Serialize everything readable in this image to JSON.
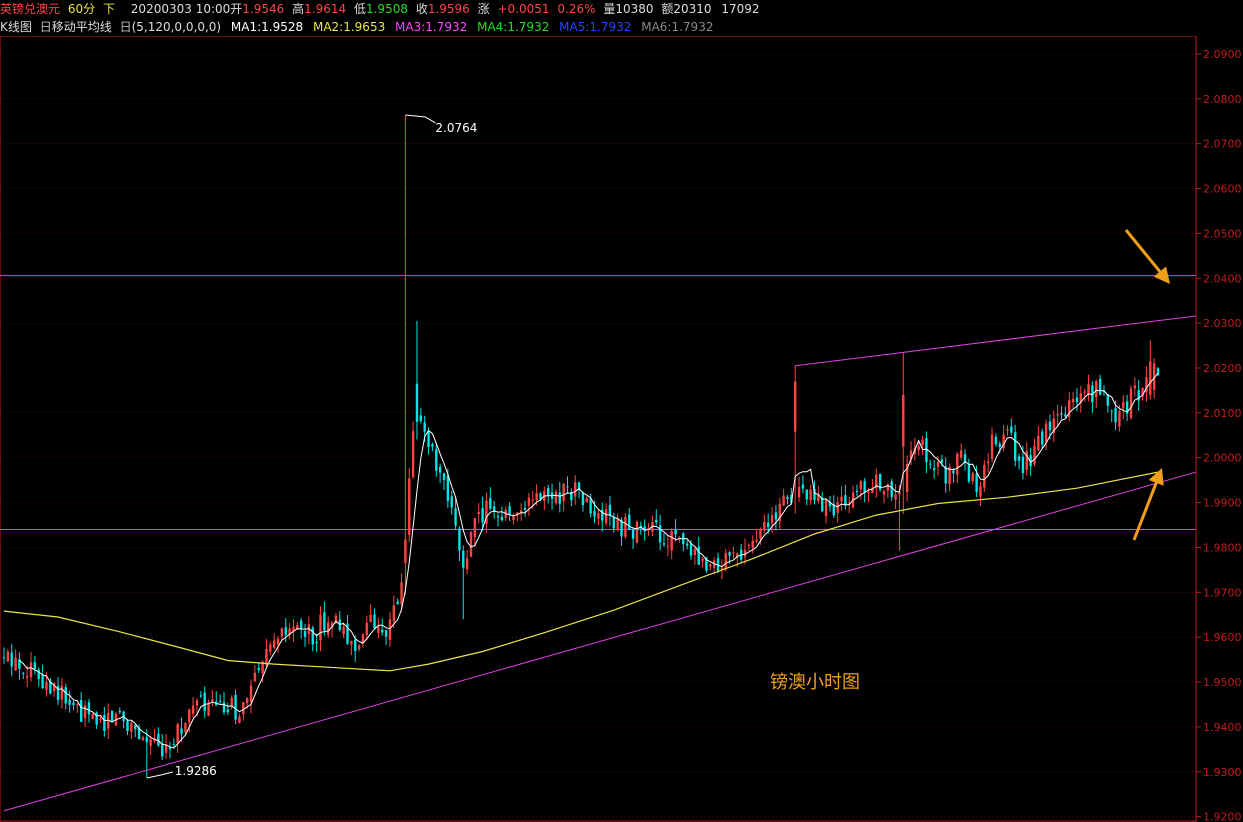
{
  "header": {
    "symbol": "英镑兑澳元",
    "period": "60分",
    "direction": "下",
    "datetime": "20200303 10:00",
    "open_label": "开",
    "open": "1.9546",
    "high_label": "高",
    "high": "1.9614",
    "low_label": "低",
    "low": "1.9508",
    "close_label": "收",
    "close": "1.9596",
    "change_label": "涨",
    "change": "+0.0051",
    "change_pct": "0.26%",
    "volume_label": "量",
    "volume": "10380",
    "amount_label": "额",
    "amount": "20310",
    "extra": "17092"
  },
  "indicator_bar": {
    "title": "K线图",
    "icon1": "日",
    "ma_name": "移动平均线",
    "icon2": "日",
    "params": "(5,120,0,0,0,0)",
    "ma1": "MA1:1.9528",
    "ma2": "MA2:1.9653",
    "ma3": "MA3:1.7932",
    "ma4": "MA4:1.7932",
    "ma5": "MA5:1.7932",
    "ma6": "MA6:1.7932"
  },
  "colors": {
    "up": "#ff4444",
    "down": "#00e5e5",
    "axis": "#c41a1a",
    "ma1": "#ffffff",
    "ma2": "#e8e44a",
    "ma3": "#ff44ff",
    "ma4": "#22dd22",
    "ma5": "#2244ff",
    "ma6": "#888888",
    "trendline": "#e040e0",
    "arrow": "#f0a018",
    "label": "#f0a018",
    "white": "#ffffff"
  },
  "chart_data": {
    "type": "candlestick",
    "ylim": [
      1.9188,
      2.094
    ],
    "y_ticks": [
      "2.0900",
      "2.0800",
      "2.0700",
      "2.0600",
      "2.0500",
      "2.0400",
      "2.0300",
      "2.0200",
      "2.0100",
      "2.0000",
      "1.9900",
      "1.9800",
      "1.9700",
      "1.9600",
      "1.9500",
      "1.9400",
      "1.9300",
      "1.9200"
    ],
    "bar_count": 300,
    "anchors": [
      [
        0,
        1.955
      ],
      [
        6,
        1.9535
      ],
      [
        12,
        1.95
      ],
      [
        18,
        1.944
      ],
      [
        24,
        1.941
      ],
      [
        30,
        1.943
      ],
      [
        36,
        1.938
      ],
      [
        40,
        1.935
      ],
      [
        45,
        1.939
      ],
      [
        50,
        1.945
      ],
      [
        56,
        1.944
      ],
      [
        62,
        1.944
      ],
      [
        66,
        1.952
      ],
      [
        70,
        1.958
      ],
      [
        75,
        1.962
      ],
      [
        80,
        1.96
      ],
      [
        84,
        1.965
      ],
      [
        90,
        1.958
      ],
      [
        95,
        1.963
      ],
      [
        100,
        1.962
      ],
      [
        103,
        1.971
      ],
      [
        106,
        2.005
      ],
      [
        108,
        2.01
      ],
      [
        111,
        2.0
      ],
      [
        115,
        1.99
      ],
      [
        119,
        1.976
      ],
      [
        122,
        1.985
      ],
      [
        126,
        1.99
      ],
      [
        130,
        1.987
      ],
      [
        136,
        1.99
      ],
      [
        142,
        1.992
      ],
      [
        148,
        1.993
      ],
      [
        152,
        1.988
      ],
      [
        158,
        1.985
      ],
      [
        164,
        1.984
      ],
      [
        170,
        1.983
      ],
      [
        176,
        1.98
      ],
      [
        182,
        1.974
      ],
      [
        188,
        1.978
      ],
      [
        194,
        1.981
      ],
      [
        200,
        1.988
      ],
      [
        206,
        1.993
      ],
      [
        210,
        1.99
      ],
      [
        216,
        1.989
      ],
      [
        220,
        1.992
      ],
      [
        226,
        1.994
      ],
      [
        232,
        1.99
      ],
      [
        236,
        2.004
      ],
      [
        240,
        2.0
      ],
      [
        244,
        1.996
      ],
      [
        248,
        2.002
      ],
      [
        252,
        1.992
      ],
      [
        256,
        2.003
      ],
      [
        260,
        2.005
      ],
      [
        264,
        1.998
      ],
      [
        268,
        2.003
      ],
      [
        272,
        2.007
      ],
      [
        276,
        2.011
      ],
      [
        280,
        2.014
      ],
      [
        284,
        2.015
      ],
      [
        288,
        2.01
      ],
      [
        292,
        2.013
      ],
      [
        296,
        2.016
      ],
      [
        299,
        2.0205
      ]
    ],
    "spikes": [
      {
        "bar": 104,
        "high": 2.0764,
        "open": 1.9765,
        "close": 1.9818
      },
      {
        "bar": 107,
        "high": 2.0305,
        "open": 2.0165,
        "close": 2.008
      },
      {
        "bar": 205,
        "high": 2.0205,
        "open": 2.0058,
        "close": 2.017
      },
      {
        "bar": 233,
        "high": 2.0235,
        "open": 2.0025,
        "close": 2.014
      },
      {
        "bar": 233,
        "high": 2.0235,
        "open": 2.0025,
        "close": 2.014
      },
      {
        "bar": 297,
        "high": 2.0262,
        "open": 2.014,
        "close": 2.0215
      }
    ],
    "dips": [
      {
        "bar": 37,
        "low": 1.9286
      },
      {
        "bar": 119,
        "low": 1.964
      },
      {
        "bar": 232,
        "low": 1.9793
      }
    ],
    "ma2_points": [
      [
        0,
        1.9658
      ],
      [
        14,
        1.9645
      ],
      [
        30,
        1.9612
      ],
      [
        45,
        1.9578
      ],
      [
        58,
        1.9548
      ],
      [
        70,
        1.954
      ],
      [
        86,
        1.9532
      ],
      [
        100,
        1.9525
      ],
      [
        110,
        1.954
      ],
      [
        124,
        1.9568
      ],
      [
        140,
        1.961
      ],
      [
        158,
        1.966
      ],
      [
        176,
        1.9718
      ],
      [
        194,
        1.9775
      ],
      [
        210,
        1.983
      ],
      [
        226,
        1.9872
      ],
      [
        242,
        1.9898
      ],
      [
        260,
        1.9912
      ],
      [
        278,
        1.9932
      ],
      [
        299,
        1.9968
      ]
    ],
    "trendlines": [
      {
        "from": [
          0,
          1.9213
        ],
        "to": [
          310,
          1.9968
        ]
      },
      {
        "from": [
          205,
          2.0205
        ],
        "to": [
          310,
          2.0316
        ]
      }
    ],
    "h_lines": [
      2.0406,
      1.984
    ],
    "peak_annotation": {
      "bar": 104,
      "price": 2.0764,
      "text": "2.0764"
    },
    "trough_annotation": {
      "bar": 37,
      "price": 1.9286,
      "text": "1.9286"
    },
    "annotation_text": "镑澳小时图"
  }
}
